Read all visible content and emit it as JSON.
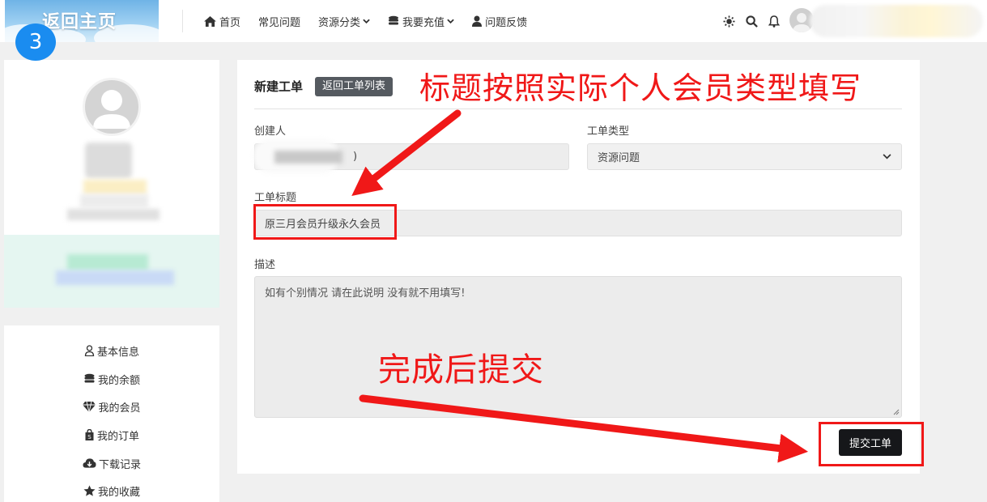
{
  "header": {
    "logo_text": "返回主页",
    "step_number": "3",
    "nav": [
      {
        "label": "首页",
        "icon": "home-icon"
      },
      {
        "label": "常见问题",
        "icon": ""
      },
      {
        "label": "资源分类",
        "icon": "",
        "has_dropdown": true
      },
      {
        "label": "我要充值",
        "icon": "coins-icon",
        "has_dropdown": true
      },
      {
        "label": "问题反馈",
        "icon": "user-icon"
      }
    ],
    "tools": [
      "theme-icon",
      "search-icon",
      "bell-icon"
    ]
  },
  "sidebar": {
    "menu": [
      {
        "label": "基本信息",
        "icon": "user-icon"
      },
      {
        "label": "我的余额",
        "icon": "coins-icon"
      },
      {
        "label": "我的会员",
        "icon": "diamond-icon"
      },
      {
        "label": "我的订单",
        "icon": "shopping-bag-icon"
      },
      {
        "label": "下载记录",
        "icon": "cloud-download-icon"
      },
      {
        "label": "我的收藏",
        "icon": "star-icon"
      }
    ]
  },
  "ticket": {
    "page_title": "新建工单",
    "back_label": "返回工单列表",
    "creator_label": "创建人",
    "creator_value_visible": ")",
    "type_label": "工单类型",
    "type_value": "资源问题",
    "title_label": "工单标题",
    "title_value": "原三月会员升级永久会员",
    "desc_label": "描述",
    "desc_value": "如有个别情况 请在此说明 没有就不用填写!",
    "submit_label": "提交工单"
  },
  "annotations": {
    "title_hint": "标题按照实际个人会员类型填写",
    "submit_hint": "完成后提交",
    "color": "#f01818"
  },
  "colors": {
    "accent_badge": "#1a8cf0",
    "submit_bg": "#16171a",
    "back_button_bg": "#555a60",
    "profile_band": "#e5f6f1"
  }
}
